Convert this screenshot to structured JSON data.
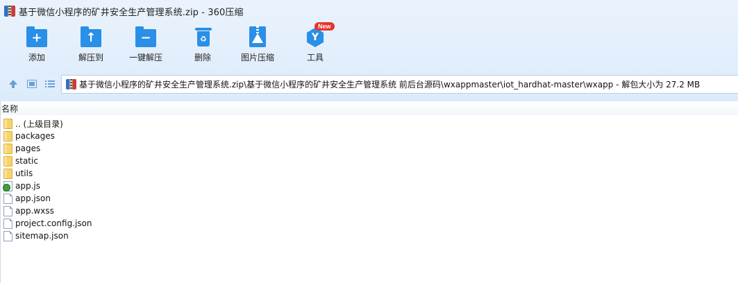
{
  "window": {
    "title": "基于微信小程序的矿井安全生产管理系统.zip - 360压缩"
  },
  "toolbar": {
    "add_label": "添加",
    "extract_to_label": "解压到",
    "one_click_extract_label": "一键解压",
    "delete_label": "删除",
    "image_compress_label": "图片压缩",
    "tools_label": "工具",
    "tools_badge": "New"
  },
  "address_bar": {
    "path": "基于微信小程序的矿井安全生产管理系统.zip\\基于微信小程序的矿井安全生产管理系统 前后台源码\\wxappmaster\\iot_hardhat-master\\wxapp - 解包大小为 27.2 MB"
  },
  "file_list": {
    "column_name": "名称",
    "items": [
      {
        "name": ".. (上级目录)",
        "type": "folder"
      },
      {
        "name": "packages",
        "type": "folder"
      },
      {
        "name": "pages",
        "type": "folder"
      },
      {
        "name": "static",
        "type": "folder"
      },
      {
        "name": "utils",
        "type": "folder"
      },
      {
        "name": "app.js",
        "type": "js"
      },
      {
        "name": "app.json",
        "type": "file"
      },
      {
        "name": "app.wxss",
        "type": "file"
      },
      {
        "name": "project.config.json",
        "type": "file"
      },
      {
        "name": "sitemap.json",
        "type": "file"
      }
    ]
  },
  "colors": {
    "accent": "#2a8fe6",
    "badge": "#e8332a"
  }
}
